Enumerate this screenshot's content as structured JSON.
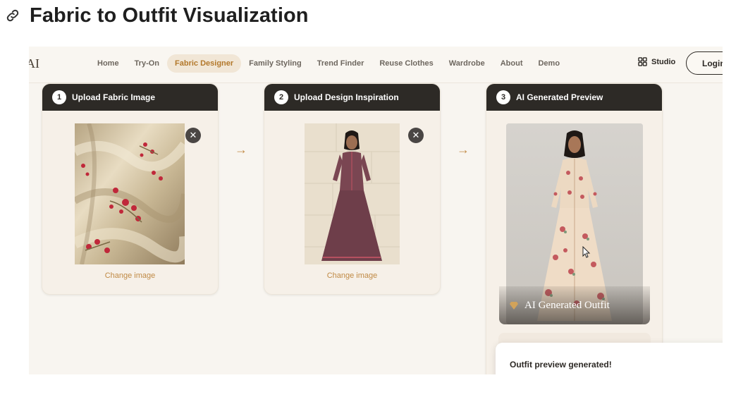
{
  "heading": {
    "title": "Fabric to Outfit Visualization",
    "icon": "link-icon"
  },
  "navbar": {
    "logo_text": "AI",
    "links": [
      "Home",
      "Try-On",
      "Fabric Designer",
      "Family Styling",
      "Trend Finder",
      "Reuse Clothes",
      "Wardrobe",
      "About",
      "Demo"
    ],
    "active_link": "Fabric Designer",
    "studio_label": "Studio",
    "login_label": "Login"
  },
  "steps": [
    {
      "number": "1",
      "title": "Upload Fabric Image",
      "change_label": "Change image"
    },
    {
      "number": "2",
      "title": "Upload Design Inspiration",
      "change_label": "Change image"
    },
    {
      "number": "3",
      "title": "AI Generated Preview",
      "overlay_label": "AI Generated Outfit"
    }
  ],
  "toast": {
    "message": "Outfit preview generated!"
  },
  "colors": {
    "accent": "#c08a45",
    "header_dark": "#2d2a26",
    "background": "#f8f5f0"
  }
}
